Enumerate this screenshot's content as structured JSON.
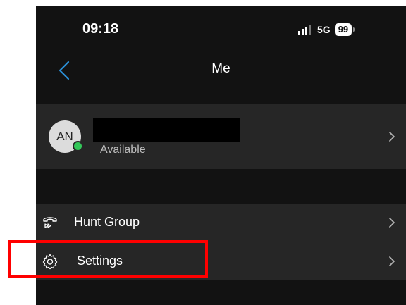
{
  "status_bar": {
    "time": "09:18",
    "network": "5G",
    "battery": "99"
  },
  "nav": {
    "title": "Me"
  },
  "profile": {
    "initials": "AN",
    "status": "Available",
    "presence_color": "#34c759"
  },
  "menu": {
    "items": [
      {
        "label": "Hunt Group",
        "icon": "hunt-group-icon"
      },
      {
        "label": "Settings",
        "icon": "gear-icon"
      }
    ]
  },
  "colors": {
    "background": "#121212",
    "row_background": "#262626",
    "highlight": "#ff0000"
  }
}
